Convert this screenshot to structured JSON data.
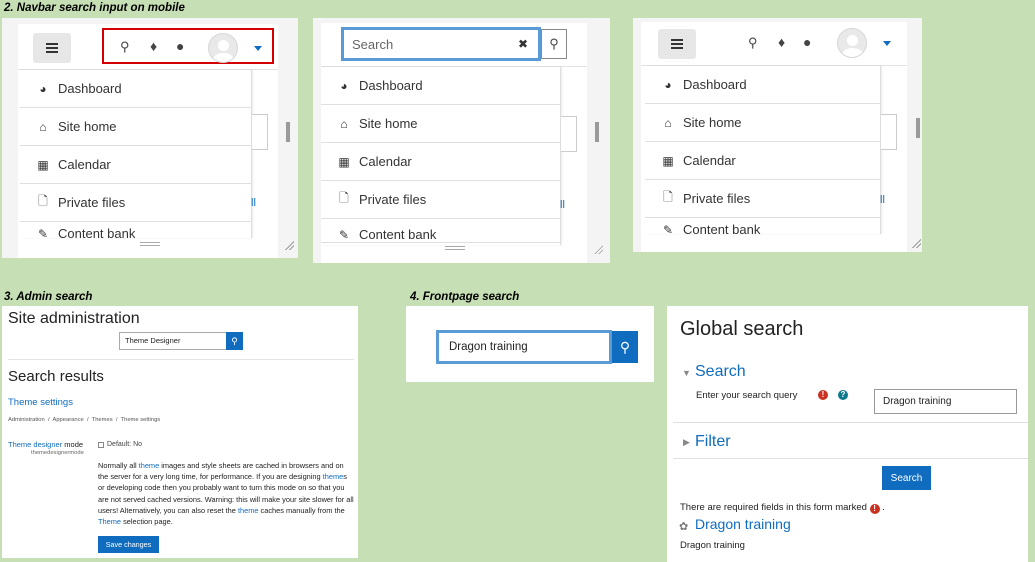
{
  "sections": {
    "navbar_search": "2. Navbar search input on mobile",
    "admin_search": "3. Admin search",
    "frontpage_search": "4. Frontpage search"
  },
  "drawer_items": [
    {
      "label": "Dashboard",
      "icon": "dashboard-icon",
      "glyph": "◕"
    },
    {
      "label": "Site home",
      "icon": "home-icon",
      "glyph": "⌂"
    },
    {
      "label": "Calendar",
      "icon": "calendar-icon",
      "glyph": "▦"
    },
    {
      "label": "Private files",
      "icon": "file-icon",
      "glyph": "🗋"
    },
    {
      "label": "Content bank",
      "icon": "pencil-icon",
      "glyph": "✎"
    }
  ],
  "navbar": {
    "search_icon": "🔍",
    "bell_icon": "🔔",
    "chat_icon": "💬",
    "search_placeholder": "Search",
    "clear_icon": "✖"
  },
  "admin": {
    "title": "Site administration",
    "search_value": "Theme Designer",
    "results_title": "Search results",
    "result_link": "Theme settings",
    "breadcrumb": "Administration  /  Appearance  /  Themes  /  Theme settings",
    "setting_name_link": "Theme designer",
    "setting_name_rest": " mode",
    "setting_key": "themedesignermode",
    "default_label": "Default: No",
    "description_parts": [
      {
        "text": "Normally all ",
        "link": false
      },
      {
        "text": "theme",
        "link": true
      },
      {
        "text": " images and style sheets are cached in browsers and on the server for a very long time, for performance. If you are designing ",
        "link": false
      },
      {
        "text": "theme",
        "link": true
      },
      {
        "text": "s or developing code then you probably want to turn this mode on so that you are not served cached versions. Warning: this will make your site slower for all users! Alternatively, you can also reset the ",
        "link": false
      },
      {
        "text": "theme",
        "link": true
      },
      {
        "text": " caches manually from the ",
        "link": false
      },
      {
        "text": "Theme",
        "link": true
      },
      {
        "text": " selection page.",
        "link": false
      }
    ],
    "save_button": "Save changes"
  },
  "frontpage": {
    "search_value": "Dragon training"
  },
  "global_search": {
    "title": "Global search",
    "search_section": "Search",
    "query_label": "Enter your search query",
    "query_value": "Dragon training",
    "filter_section": "Filter",
    "submit_button": "Search",
    "required_note": "There are required fields in this form marked",
    "result_title": "Dragon training",
    "result_snippet": "Dragon training"
  },
  "colors": {
    "background": "#c6dfb4",
    "brand_blue": "#0f6cbf",
    "highlight_red": "#d40000",
    "focus_blue": "#5b9bd5",
    "required_red": "#ca3120"
  }
}
